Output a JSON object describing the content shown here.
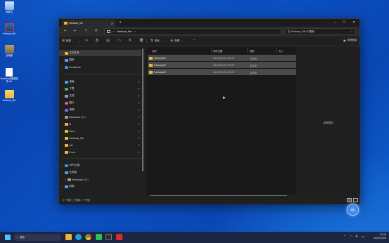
{
  "desktop": {
    "icons": [
      {
        "label": "回收站",
        "icon": "recycle-bin-icon"
      },
      {
        "label": "Hadoop-Jdk",
        "icon": "app-shortcut-icon"
      },
      {
        "label": "此电脑",
        "icon": "computer-icon"
      },
      {
        "label": "Hadoop大数据组件.txt",
        "icon": "document-icon"
      },
      {
        "label": "Hadoop_file",
        "icon": "folder-icon"
      }
    ]
  },
  "window": {
    "tab_title": "Hadoop_file",
    "tab_close": "×",
    "new_tab": "+",
    "controls": {
      "minimize": "—",
      "maximize": "☐",
      "close": "✕"
    }
  },
  "nav": {
    "back": "←",
    "forward": "→",
    "up": "↑",
    "refresh": "⟳",
    "address_segments": [
      "Hadoop_file",
      ">"
    ],
    "address_chevron": ">",
    "search_placeholder": "在 Hadoop_file 中搜索",
    "search_icon": "⌕"
  },
  "toolbar": {
    "new_label": "新建",
    "sort_label": "排序",
    "view_label": "查看",
    "more_label": "···",
    "details_label": "详细信息"
  },
  "sidebar": {
    "top": [
      {
        "label": "主文件夹",
        "icon": "home-icon",
        "color": "#e8b63d"
      },
      {
        "label": "图库",
        "icon": "gallery-icon",
        "color": "#4aa3f0"
      },
      {
        "label": "OneDrive",
        "icon": "cloud-icon",
        "color": "#3b8be0"
      }
    ],
    "quick_access": [
      {
        "label": "桌面",
        "icon": "desktop-icon",
        "color": "#4aa3f0"
      },
      {
        "label": "下载",
        "icon": "download-icon",
        "color": "#3fb57d"
      },
      {
        "label": "文档",
        "icon": "documents-icon",
        "color": "#8aa0c0"
      },
      {
        "label": "图片",
        "icon": "pictures-icon",
        "color": "#d861a8"
      },
      {
        "label": "视频",
        "icon": "videos-icon",
        "color": "#8a62d8"
      },
      {
        "label": "Windows (C:)",
        "icon": "drive-icon",
        "color": "#9a9a9a"
      },
      {
        "label": "B",
        "icon": "folder-icon",
        "color": "#e8b63d"
      },
      {
        "label": "docs",
        "icon": "folder-icon",
        "color": "#e8b63d"
      },
      {
        "label": "Hadoop_file",
        "icon": "folder-icon",
        "color": "#e8b63d"
      },
      {
        "label": "etc",
        "icon": "folder-icon",
        "color": "#e8b63d"
      },
      {
        "label": "linux",
        "icon": "folder-icon",
        "color": "#e8b63d"
      }
    ],
    "bottom": [
      {
        "label": "WPS云盘",
        "icon": "wps-cloud-icon",
        "color": "#3b8be0"
      },
      {
        "label": "此电脑",
        "icon": "computer-icon",
        "color": "#4aa3f0"
      },
      {
        "label": "Windows (C:)",
        "icon": "drive-icon",
        "color": "#9a9a9a"
      },
      {
        "label": "网络",
        "icon": "network-icon",
        "color": "#4aa3f0"
      }
    ],
    "pin_glyph": "📌"
  },
  "content": {
    "columns": [
      "名称",
      "修改日期",
      "类型",
      "大小"
    ],
    "rows": [
      {
        "name": "hadoop01",
        "modified": "2025/12/04 22:27",
        "type": "文件夹",
        "size": ""
      },
      {
        "name": "hadoop02",
        "modified": "2025/12/04 22:27",
        "type": "文件夹",
        "size": ""
      },
      {
        "name": "hadoop03",
        "modified": "2025/12/04 22:27",
        "type": "文件夹",
        "size": ""
      }
    ]
  },
  "preview": {
    "text": "没有预览。"
  },
  "status": {
    "text": "3 个项目  |  已选择 3 个项目"
  },
  "overlay_bubble": {
    "text": "20%"
  },
  "taskbar": {
    "search_label": "搜索",
    "apps": [
      {
        "name": "file-explorer",
        "color": "#e8b63d"
      },
      {
        "name": "edge",
        "color": "#1fa1e0"
      },
      {
        "name": "chrome",
        "color": "#e04a3b"
      },
      {
        "name": "wechat",
        "color": "#2dbf5a"
      },
      {
        "name": "terminal",
        "color": "#2b2b2b"
      },
      {
        "name": "app-red",
        "color": "#d62d2d"
      }
    ],
    "tray": {
      "chevron": "^",
      "wifi": "◠",
      "volume": "🔊",
      "battery": "▭"
    },
    "time": "22:26",
    "date": "2025/12/04"
  }
}
